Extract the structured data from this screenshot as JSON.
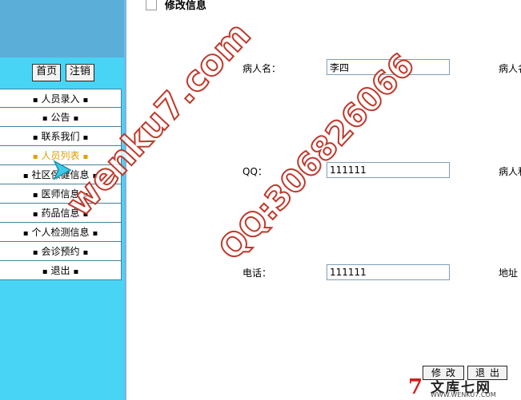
{
  "sidebar": {
    "top_buttons": [
      "首页",
      "注销"
    ],
    "items": [
      {
        "label": "人员录入",
        "active": false
      },
      {
        "label": "公告",
        "active": false
      },
      {
        "label": "联系我们",
        "active": false
      },
      {
        "label": "人员列表",
        "active": true
      },
      {
        "label": "社区保健信息",
        "active": false
      },
      {
        "label": "医师信息",
        "active": false
      },
      {
        "label": "药品信息",
        "active": false
      },
      {
        "label": "个人检测信息",
        "active": false
      },
      {
        "label": "会诊预约",
        "active": false
      },
      {
        "label": "退出",
        "active": false
      }
    ],
    "dot": "▪"
  },
  "main": {
    "title": "修改信息",
    "fields": {
      "patient_name": {
        "label": "病人名：",
        "value": "李四"
      },
      "patient_right_1": {
        "label": "病人名"
      },
      "qq": {
        "label": "QQ：",
        "value": "111111"
      },
      "patient_right_2": {
        "label": "病人和"
      },
      "phone": {
        "label": "电话：",
        "value": "111111"
      },
      "address": {
        "label": "地址"
      }
    },
    "buttons": {
      "modify": "修改",
      "back": "退出"
    }
  },
  "watermark": {
    "site": "wenku7.com",
    "qq": "QQ:306826066",
    "logo_cn": "文库七网",
    "logo_url": "WWW.WENKU7.COM"
  },
  "colors": {
    "sidebar_bg": "#48d4f4",
    "sidebar_header": "#5aaed8",
    "active_item": "#e0a000",
    "watermark": "#c0392b"
  }
}
